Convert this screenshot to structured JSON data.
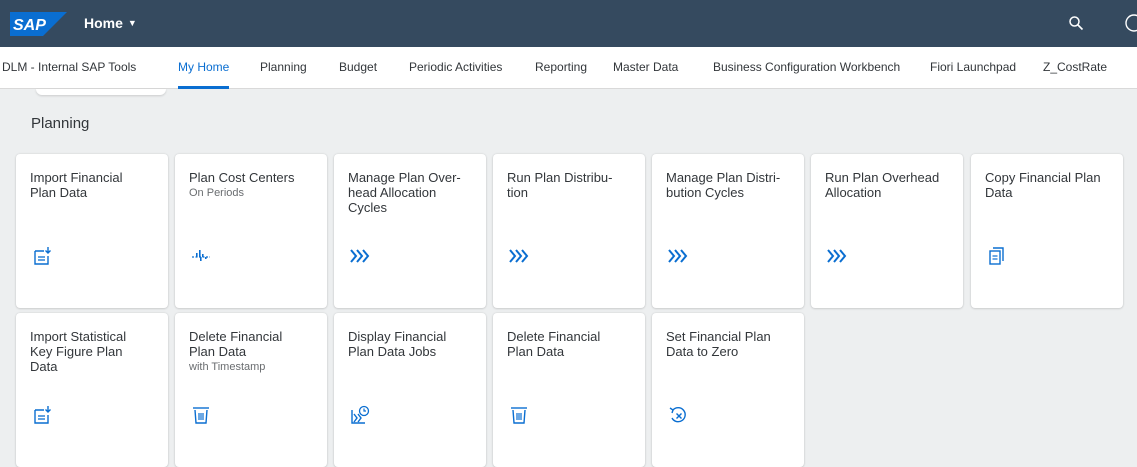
{
  "shell": {
    "logo_text": "SAP",
    "title": "Home",
    "colors": {
      "shell_bg": "#354a5f",
      "accent": "#0a6ed1",
      "logo_blue": "#0a6ed1"
    }
  },
  "tabs": [
    {
      "label": "DLM - Internal SAP Tools",
      "active": false
    },
    {
      "label": "My Home",
      "active": true
    },
    {
      "label": "Planning",
      "active": false
    },
    {
      "label": "Budget",
      "active": false
    },
    {
      "label": "Periodic Activities",
      "active": false
    },
    {
      "label": "Reporting",
      "active": false
    },
    {
      "label": "Master Data",
      "active": false
    },
    {
      "label": "Business Configuration Workbench",
      "active": false
    },
    {
      "label": "Fiori Launchpad",
      "active": false
    },
    {
      "label": "Z_CostRate",
      "active": false
    }
  ],
  "group": {
    "title": "Planning",
    "tiles": [
      {
        "title": "Import Financial\nPlan Data",
        "subtitle": "",
        "icon": "import-icon"
      },
      {
        "title": "Plan Cost Centers",
        "subtitle": "On Periods",
        "icon": "cost-distribution-icon"
      },
      {
        "title": "Manage Plan Over-\nhead Allocation\nCycles",
        "subtitle": "",
        "icon": "process-chevrons-icon"
      },
      {
        "title": "Run Plan Distribu-\ntion",
        "subtitle": "",
        "icon": "process-chevrons-icon"
      },
      {
        "title": "Manage Plan Distri-\nbution Cycles",
        "subtitle": "",
        "icon": "process-chevrons-icon"
      },
      {
        "title": "Run Plan Overhead\nAllocation",
        "subtitle": "",
        "icon": "process-chevrons-icon"
      },
      {
        "title": "Copy Financial Plan\nData",
        "subtitle": "",
        "icon": "copy-icon"
      },
      {
        "title": "Import Statistical\nKey Figure Plan\nData",
        "subtitle": "",
        "icon": "import-icon"
      },
      {
        "title": "Delete Financial\nPlan Data",
        "subtitle": "with Timestamp",
        "icon": "delete-icon"
      },
      {
        "title": "Display Financial\nPlan Data Jobs",
        "subtitle": "",
        "icon": "scheduled-jobs-icon"
      },
      {
        "title": "Delete Financial\nPlan Data",
        "subtitle": "",
        "icon": "delete-icon"
      },
      {
        "title": "Set Financial Plan\nData to Zero",
        "subtitle": "",
        "icon": "reset-icon"
      }
    ]
  }
}
